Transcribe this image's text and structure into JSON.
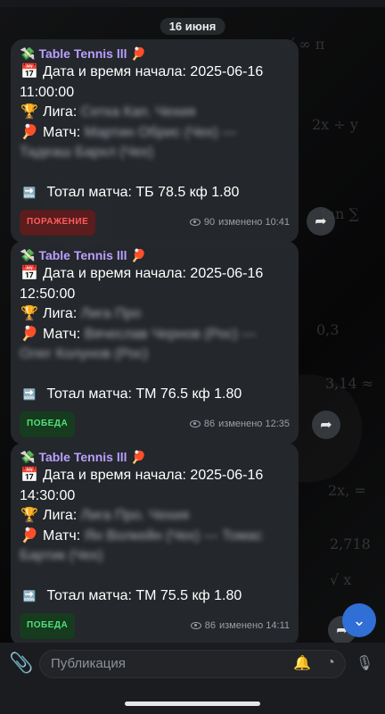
{
  "date_separator": "16 июня",
  "messages": [
    {
      "title": "Table Tennis lll",
      "icons": {
        "title": "money-icon",
        "title_end": "ping-pong-icon",
        "date": "calendar-icon",
        "league": "trophy-icon",
        "match": "ping-pong-icon",
        "total": "soon-arrow-icon"
      },
      "start_label": "Дата и время начала:",
      "start_date": "2025-06-16",
      "start_time": "11:00:00",
      "league_label": "Лига:",
      "league_value": "Сетка Кап. Чехия",
      "match_label": "Матч:",
      "match_value": "Мартин Обрис (Чех) — Тадеаш Бархл (Чех)",
      "total_text": "Тотал матча: ТБ 78.5 кф 1.80",
      "result": "ПОРАЖЕНИЕ",
      "result_type": "lose",
      "views": "90",
      "edited": "изменено 10:41"
    },
    {
      "title": "Table Tennis lll",
      "icons": {
        "title": "money-icon",
        "title_end": "ping-pong-icon",
        "date": "calendar-icon",
        "league": "trophy-icon",
        "match": "ping-pong-icon",
        "total": "soon-arrow-icon"
      },
      "start_label": "Дата и время начала:",
      "start_date": "2025-06-16",
      "start_time": "12:50:00",
      "league_label": "Лига:",
      "league_value": "Лига Про",
      "match_label": "Матч:",
      "match_value": "Вячеслав Чернов (Рос) — Олег Колунов (Рос)",
      "total_text": "Тотал матча: ТМ 76.5 кф 1.80",
      "result": "ПОБЕДА",
      "result_type": "win",
      "views": "86",
      "edited": "изменено 12:35"
    },
    {
      "title": "Table Tennis lll",
      "icons": {
        "title": "money-icon",
        "title_end": "ping-pong-icon",
        "date": "calendar-icon",
        "league": "trophy-icon",
        "match": "ping-pong-icon",
        "total": "soon-arrow-icon"
      },
      "start_label": "Дата и время начала:",
      "start_date": "2025-06-16",
      "start_time": "14:30:00",
      "league_label": "Лига:",
      "league_value": "Лига Про. Чехия",
      "match_label": "Матч:",
      "match_value": "Ян Волкейн (Чех) — Томас Бартик (Чех)",
      "total_text": "Тотал матча: ТМ 75.5 кф 1.80",
      "result": "ПОБЕДА",
      "result_type": "win",
      "views": "86",
      "edited": "изменено 14:11"
    }
  ],
  "composer": {
    "placeholder": "Публикация"
  },
  "colors": {
    "title": "#b9a0ff",
    "win": "#52e07a",
    "lose": "#ff5c5c",
    "accent": "#2f6fd6"
  }
}
